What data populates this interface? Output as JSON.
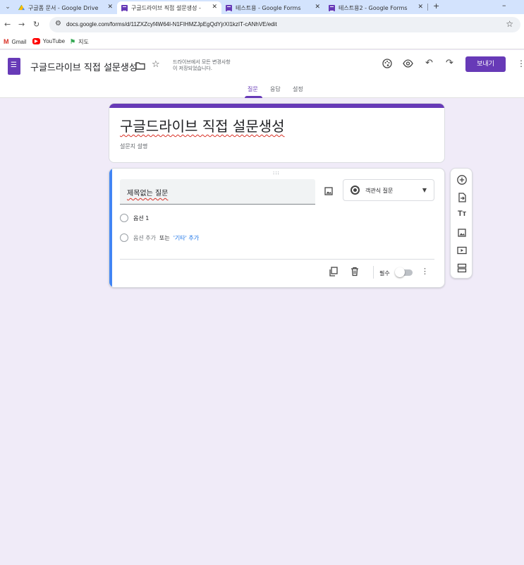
{
  "browser": {
    "tabs": [
      {
        "title": "구글폼 문서 - Google Drive",
        "favicon": "drive-icon"
      },
      {
        "title": "구글드라이브 직접 설문생성 -",
        "favicon": "forms-icon",
        "active": true
      },
      {
        "title": "테스트용 - Google Forms",
        "favicon": "forms-icon"
      },
      {
        "title": "테스트용2 - Google Forms",
        "favicon": "forms-icon"
      }
    ],
    "url": "docs.google.com/forms/d/11ZXZcyf4W64l-N1FIHMZJpEgQdYjrXI1kzIT-cANhVE/edit",
    "bookmarks": [
      {
        "label": "Gmail"
      },
      {
        "label": "YouTube"
      },
      {
        "label": "지도"
      }
    ]
  },
  "header": {
    "doc_title": "구글드라이브 직접 설문생성",
    "save_status_line1": "드라이브에서 모든 변경사항",
    "save_status_line2": "이 저장되었습니다.",
    "send_label": "보내기",
    "tabs": [
      {
        "label": "질문",
        "active": true
      },
      {
        "label": "응답"
      },
      {
        "label": "설정"
      }
    ]
  },
  "form": {
    "title": "구글드라이브 직접 설문생성",
    "description": "설문지 설명"
  },
  "question": {
    "title": "제목없는 질문",
    "type": "객관식 질문",
    "options": [
      "옵션 1"
    ],
    "add_option": "옵션 추가",
    "or": "또는",
    "add_other": "'기타' 추가",
    "required_label": "필수"
  },
  "colors": {
    "accent": "#673ab7",
    "background": "#f0ebf8",
    "active_question": "#4285f4",
    "link": "#1a73e8"
  }
}
